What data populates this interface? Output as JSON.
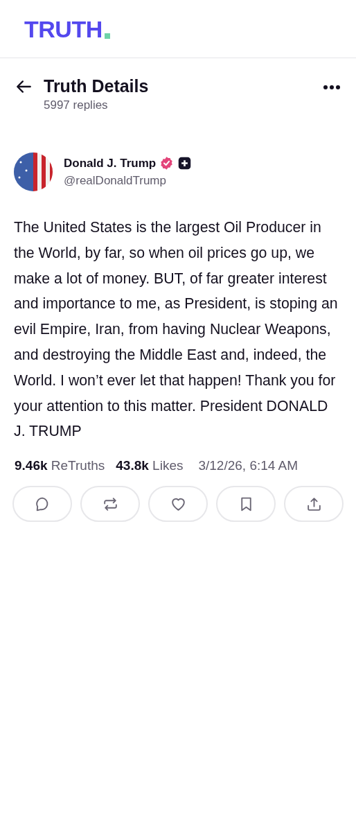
{
  "logo": {
    "text": "TRUTH"
  },
  "header": {
    "title": "Truth Details",
    "subtitle": "5997 replies"
  },
  "post": {
    "author": {
      "name": "Donald J. Trump",
      "verified": true,
      "handle": "@realDonaldTrump"
    },
    "text": "The United States is the largest Oil Producer in the World, by far, so when oil prices go up, we make a lot of money. BUT, of far greater interest and importance to me, as President, is stoping an evil Empire, Iran, from having Nuclear Weapons, and destroying the Middle East and, indeed, the World. I won’t ever let that happen! Thank you for your attention to this matter. President DONALD J. TRUMP",
    "stats": [
      {
        "count": "9.46k",
        "label": "ReTruths"
      },
      {
        "count": "43.8k",
        "label": "Likes"
      }
    ],
    "timestamp": "3/12/26, 6:14 AM",
    "actions": [
      {
        "kind": "reply"
      },
      {
        "kind": "retruth"
      },
      {
        "kind": "like"
      },
      {
        "kind": "bookmark"
      },
      {
        "kind": "share"
      }
    ]
  }
}
